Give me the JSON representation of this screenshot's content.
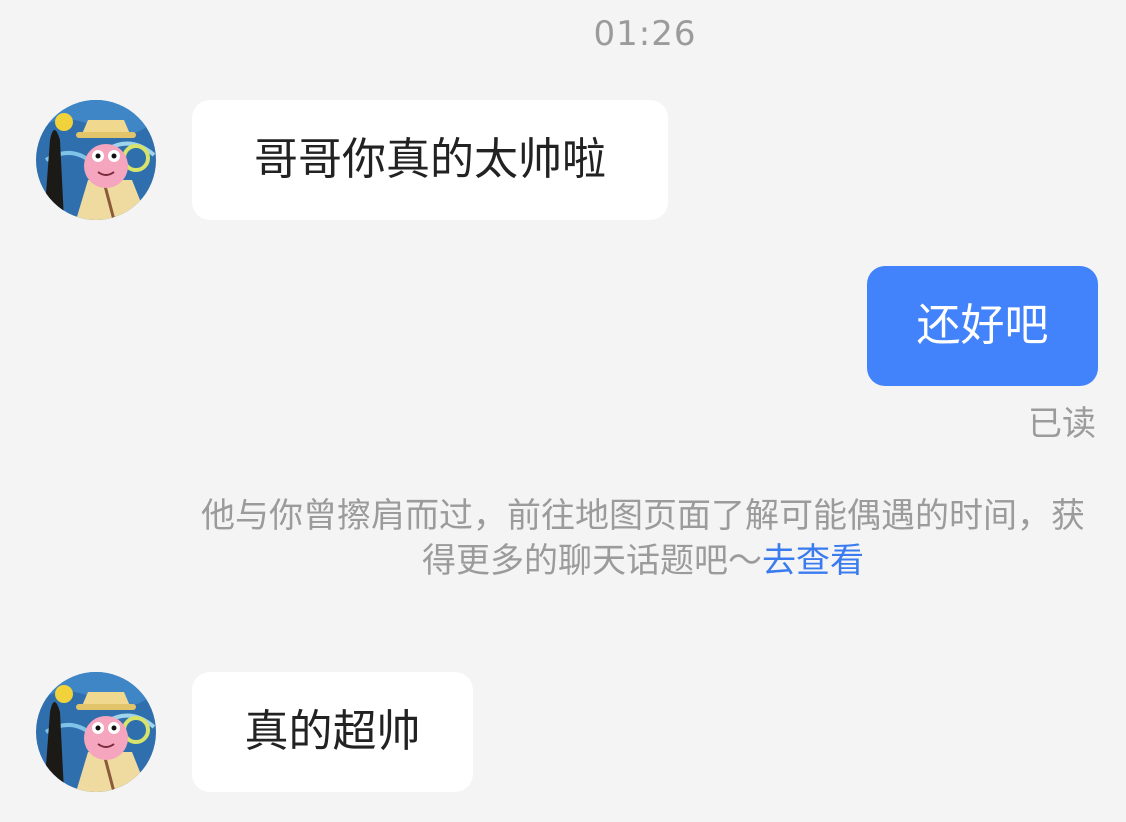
{
  "status": {
    "time": "01:26"
  },
  "messages": [
    {
      "direction": "incoming",
      "avatar_icon": "patrick-starry-night-avatar",
      "text": "哥哥你真的太帅啦"
    },
    {
      "direction": "outgoing",
      "text": "还好吧",
      "read_status": "已读"
    },
    {
      "direction": "incoming",
      "avatar_icon": "patrick-starry-night-avatar",
      "text": "真的超帅"
    }
  ],
  "system_notice": {
    "line1": "他与你曾擦肩而过，前往地图页面了解可能偶遇的时间，获",
    "line2": "得更多的聊天话题吧～",
    "link_text": "去查看"
  },
  "colors": {
    "background": "#f4f4f4",
    "incoming_bubble": "#ffffff",
    "outgoing_bubble": "#4282fb",
    "link": "#3a7bf0",
    "meta_text": "#9b9b9b"
  }
}
